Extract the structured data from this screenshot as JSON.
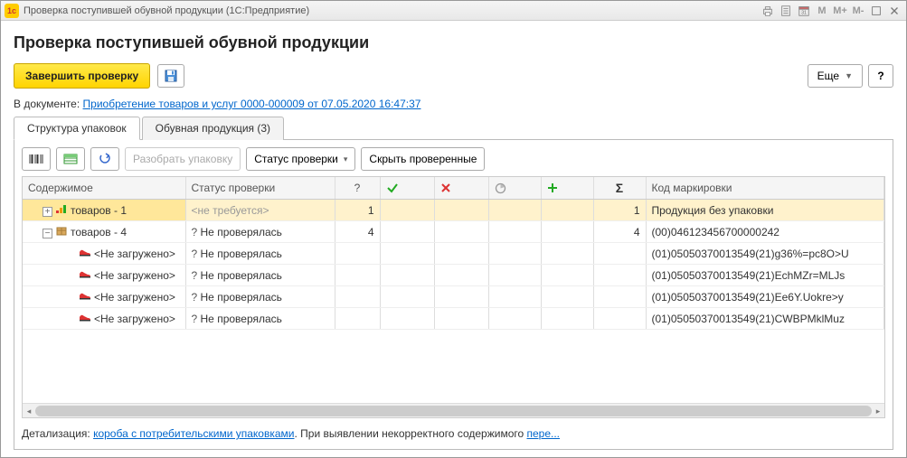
{
  "window": {
    "title": "Проверка поступившей обувной продукции  (1С:Предприятие)",
    "sys_m": "M",
    "sys_mplus": "M+",
    "sys_mminus": "M-"
  },
  "header": {
    "title": "Проверка поступившей обувной продукции",
    "finish_btn": "Завершить проверку",
    "more_btn": "Еще",
    "help_btn": "?",
    "doc_label": "В документе:  ",
    "doc_link": "Приобретение товаров и услуг 0000-000009 от 07.05.2020 16:47:37"
  },
  "tabs": {
    "t1": "Структура упаковок",
    "t2": "Обувная продукция (3)"
  },
  "toolbar": {
    "disassemble": "Разобрать упаковку",
    "status": "Статус проверки",
    "hide_checked": "Скрыть проверенные"
  },
  "grid": {
    "headers": {
      "content": "Содержимое",
      "status": "Статус проверки",
      "q": "?",
      "sigma": "Σ",
      "code": "Код маркировки"
    },
    "rows": [
      {
        "kind": "group-open",
        "selected": true,
        "indent": 1,
        "content": "товаров - 1",
        "status": "<не требуется>",
        "q": "1",
        "sigma": "1",
        "code": "Продукция без упаковки"
      },
      {
        "kind": "group-box",
        "indent": 1,
        "content": "товаров - 4",
        "status_prefix": "?  ",
        "status": "Не проверялась",
        "q": "4",
        "sigma": "4",
        "code": "(00)046123456700000242"
      },
      {
        "kind": "item",
        "indent": 2,
        "content": "<Не загружено>",
        "status_prefix": "?  ",
        "status": "Не проверялась",
        "code": "(01)05050370013549(21)g36%=pc8O>U"
      },
      {
        "kind": "item",
        "indent": 2,
        "content": "<Не загружено>",
        "status_prefix": "?  ",
        "status": "Не проверялась",
        "code": "(01)05050370013549(21)EchMZr=MLJs"
      },
      {
        "kind": "item",
        "indent": 2,
        "content": "<Не загружено>",
        "status_prefix": "?  ",
        "status": "Не проверялась",
        "code": "(01)05050370013549(21)Ee6Y.Uokre>y"
      },
      {
        "kind": "item",
        "indent": 2,
        "content": "<Не загружено>",
        "status_prefix": "?  ",
        "status": "Не проверялась",
        "code": "(01)05050370013549(21)CWBPMklMuz"
      }
    ]
  },
  "footer": {
    "detail_label": "Детализация: ",
    "detail_link": "короба с потребительскими упаковками",
    "detail_rest": ". При выявлении некорректного содержимого ",
    "detail_more": "пере..."
  }
}
